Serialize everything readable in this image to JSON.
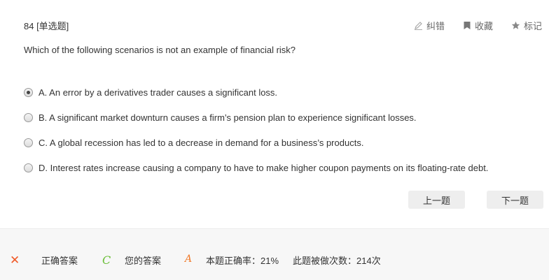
{
  "question": {
    "number_label": "84 [单选题]",
    "stem": "Which of the following scenarios is not an example of financial risk?",
    "selected_index": 0
  },
  "actions": {
    "report_error": "纠错",
    "favorite": "收藏",
    "mark": "标记"
  },
  "options": [
    {
      "label": "A. An error by a derivatives trader causes a significant loss."
    },
    {
      "label": "B. A significant market downturn causes a firm’s pension plan to experience significant losses."
    },
    {
      "label": "C. A global recession has led to a decrease in demand for a business’s products."
    },
    {
      "label": "D. Interest rates increase causing a company to have to make higher coupon payments on its floating-rate debt."
    }
  ],
  "navigation": {
    "prev_label": "上一题",
    "next_label": "下一题"
  },
  "footer": {
    "wrong_symbol": "✕",
    "correct_answer_label": "正确答案",
    "correct_answer_value": "C",
    "your_answer_label": "您的答案",
    "your_answer_value": "A",
    "accuracy_text": "本题正确率：21%",
    "attempts_text": "此题被做次数：214次",
    "colors": {
      "wrong": "#f05a28",
      "correct": "#6cbf3a",
      "yours": "#f07a2a"
    }
  }
}
